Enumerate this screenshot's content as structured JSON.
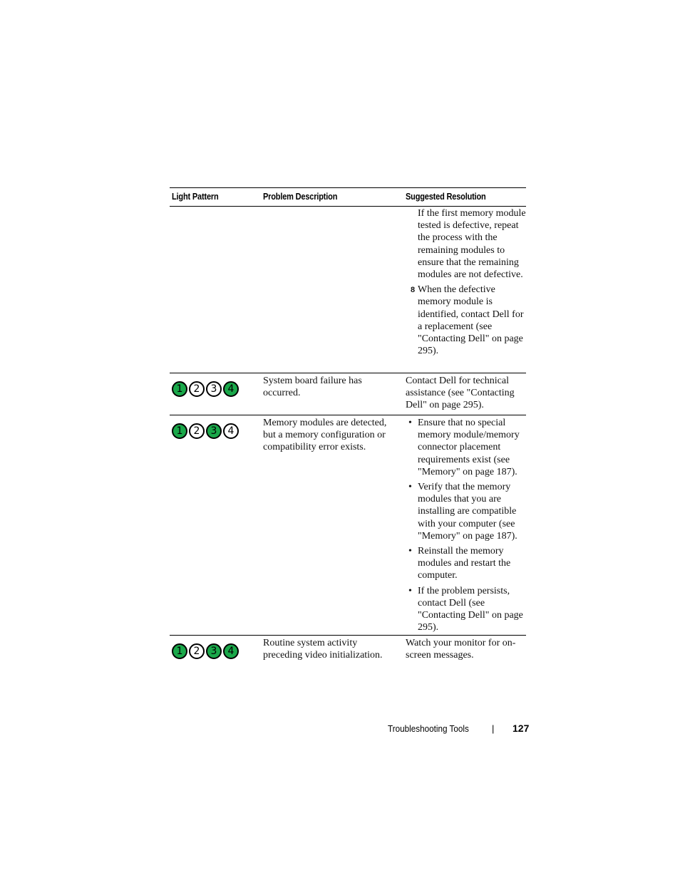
{
  "table": {
    "headers": {
      "light_pattern": "Light Pattern",
      "problem_description": "Problem Description",
      "suggested_resolution": "Suggested Resolution"
    },
    "continued_row": {
      "resolution_text": "If the first memory module tested is defective, repeat the process with the remaining modules to ensure that the remaining modules are not defective.",
      "step_8_number": "8",
      "step_8_text": "When the defective memory module is identified, contact Dell for a replacement (see \"Contacting Dell\" on page 295)."
    },
    "rows": [
      {
        "lights": [
          {
            "label": "1",
            "state": "on"
          },
          {
            "label": "2",
            "state": "off"
          },
          {
            "label": "3",
            "state": "off"
          },
          {
            "label": "4",
            "state": "on"
          }
        ],
        "description": "System board failure has occurred.",
        "resolution": "Contact Dell for technical assistance (see \"Contacting Dell\" on page 295)."
      },
      {
        "lights": [
          {
            "label": "1",
            "state": "on"
          },
          {
            "label": "2",
            "state": "off"
          },
          {
            "label": "3",
            "state": "on"
          },
          {
            "label": "4",
            "state": "off"
          }
        ],
        "description": "Memory modules are detected, but a memory configuration or compatibility error exists.",
        "bullet_symbol": "•",
        "resolution_bullets": [
          "Ensure that no special memory module/memory connector placement requirements exist (see \"Memory\" on page 187).",
          "Verify that the memory modules that you are installing are compatible with your computer (see \"Memory\" on page 187).",
          "Reinstall the memory modules and restart the computer.",
          "If the problem persists, contact Dell (see \"Contacting Dell\" on page 295)."
        ]
      },
      {
        "lights": [
          {
            "label": "1",
            "state": "on"
          },
          {
            "label": "2",
            "state": "off"
          },
          {
            "label": "3",
            "state": "on"
          },
          {
            "label": "4",
            "state": "on"
          }
        ],
        "description": "Routine system activity preceding video initialization.",
        "resolution": "Watch your monitor for on-screen messages."
      }
    ]
  },
  "colors": {
    "led_on": "#1aa84a",
    "led_off": "#ffffff"
  },
  "footer": {
    "section": "Troubleshooting Tools",
    "separator": "|",
    "page_number": "127"
  }
}
